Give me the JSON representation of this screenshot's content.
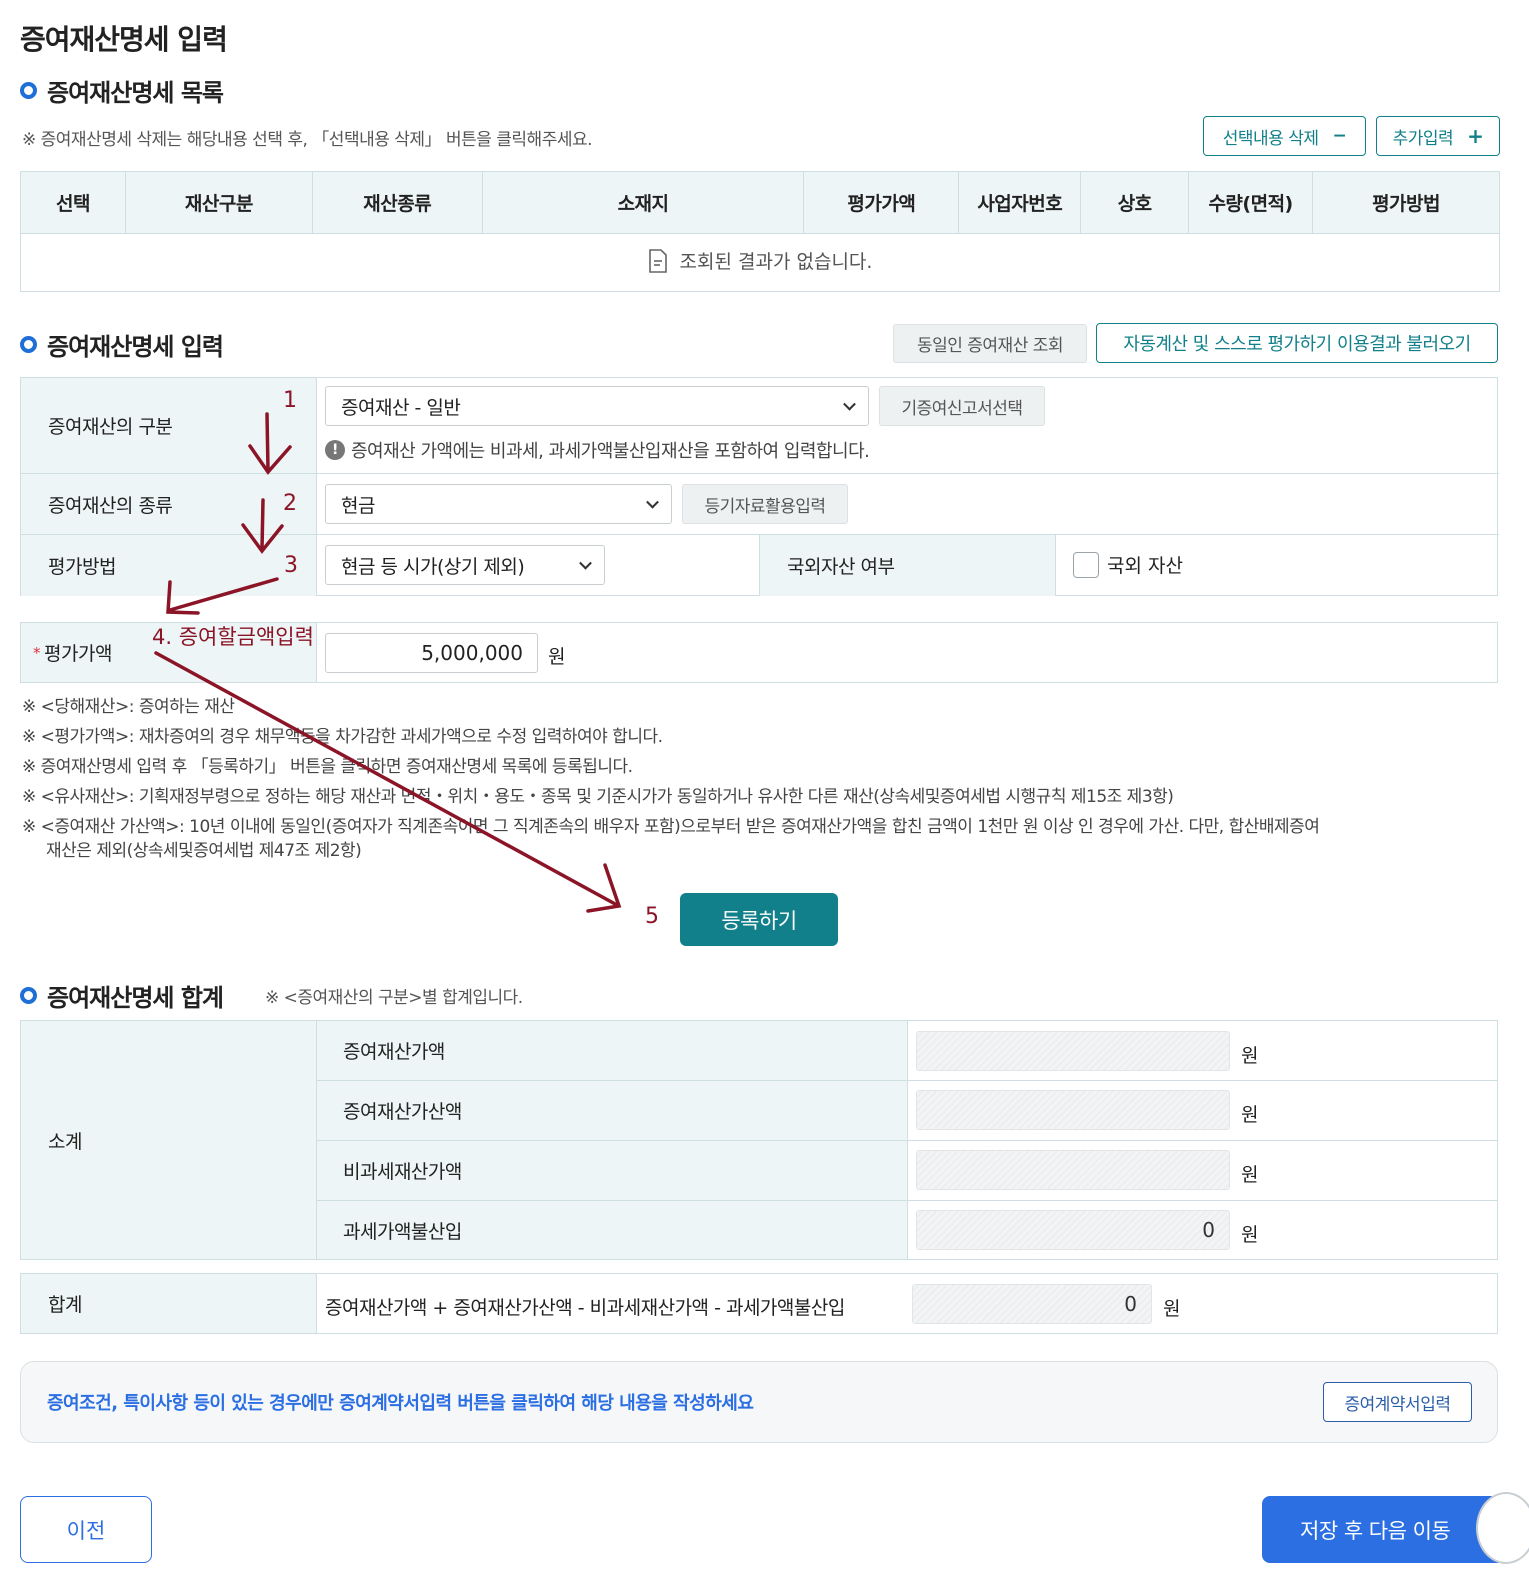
{
  "page_title": "증여재산명세 입력",
  "list_section": {
    "title": "증여재산명세 목록",
    "note": "※ 증여재산명세 삭제는 해당내용 선택 후, 「선택내용 삭제」 버튼을 클릭해주세요.",
    "delete_button": "선택내용 삭제",
    "delete_symbol": "−",
    "add_button": "추가입력",
    "add_symbol": "+",
    "columns": [
      "선택",
      "재산구분",
      "재산종류",
      "소재지",
      "평가가액",
      "사업자번호",
      "상호",
      "수량(면적)",
      "평가방법"
    ],
    "empty_message": "조회된 결과가 없습니다."
  },
  "input_section": {
    "title": "증여재산명세 입력",
    "same_person_button": "동일인 증여재산 조회",
    "load_results_button": "자동계산 및 스스로 평가하기 이용결과 불러오기",
    "category_label": "증여재산의 구분",
    "category_value": "증여재산 - 일반",
    "prior_report_button": "기증여신고서선택",
    "category_info": "증여재산 가액에는 비과세, 과세가액불산입재산을 포함하여 입력합니다.",
    "type_label": "증여재산의 종류",
    "type_value": "현금",
    "registry_button": "등기자료활용입력",
    "method_label": "평가방법",
    "method_value": "현금 등 시가(상기 제외)",
    "foreign_label": "국외자산 여부",
    "foreign_checkbox_label": "국외 자산",
    "required_mark": "*",
    "amount_label": "평가가액",
    "amount_value": "5,000,000",
    "unit": "원",
    "notes": [
      "※ <당해재산>: 증여하는 재산",
      "※ <평가가액>: 재차증여의 경우 채무액등을 차가감한 과세가액으로 수정 입력하여야 합니다.",
      "※ 증여재산명세 입력 후 「등록하기」 버튼을 클릭하면 증여재산명세 목록에 등록됩니다.",
      "※ <유사재산>: 기획재정부령으로 정하는 해당 재산과 면적・위치・용도・종목 및 기준시가가 동일하거나 유사한 다른 재산(상속세및증여세법 시행규칙 제15조 제3항)",
      "※ <증여재산 가산액>: 10년 이내에 동일인(증여자가 직계존속이면 그 직계존속의 배우자 포함)으로부터 받은 증여재산가액을 합친 금액이 1천만 원 이상 인 경우에 가산. 다만, 합산배제증여",
      "재산은 제외(상속세및증여세법 제47조 제2항)"
    ],
    "register_button": "등록하기"
  },
  "annotations": {
    "n1": "1",
    "n2": "2",
    "n3": "3",
    "n4": "4. 증여할금액입력",
    "n5": "5"
  },
  "summary_section": {
    "title": "증여재산명세 합계",
    "note": "※ <증여재산의 구분>별 합계입니다.",
    "subtotal_label": "소계",
    "rows": [
      {
        "label": "증여재산가액",
        "value": ""
      },
      {
        "label": "증여재산가산액",
        "value": ""
      },
      {
        "label": "비과세재산가액",
        "value": ""
      },
      {
        "label": "과세가액불산입",
        "value": "0"
      }
    ],
    "total_label": "합계",
    "total_formula": "증여재산가액 + 증여재산가산액 - 비과세재산가액 - 과세가액불산입",
    "total_value": "0",
    "unit": "원"
  },
  "contract_box": {
    "text": "증여조건, 특이사항 등이 있는 경우에만 증여계약서입력 버튼을 클릭하여 해당 내용을 작성하세요",
    "button": "증여계약서입력"
  },
  "footer": {
    "prev_button": "이전",
    "next_button": "저장 후 다음 이동"
  },
  "colors": {
    "accent_teal": "#12808a",
    "primary_blue": "#2b6fe3",
    "annotation_red": "#8b1527",
    "header_bg": "#eef5f6"
  }
}
